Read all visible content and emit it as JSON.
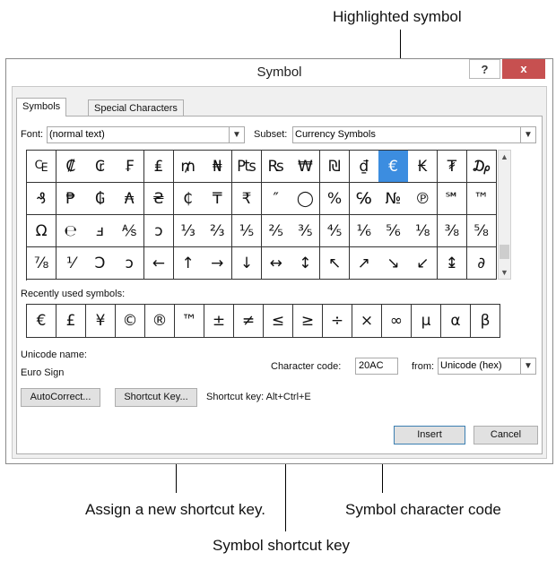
{
  "callouts": {
    "highlighted_symbol": "Highlighted symbol",
    "assign_shortcut": "Assign a new shortcut key.",
    "character_code": "Symbol character code",
    "shortcut_key": "Symbol shortcut key"
  },
  "dialog": {
    "title": "Symbol",
    "help_label": "?",
    "close_label": "x"
  },
  "tabs": [
    {
      "label": "Symbols"
    },
    {
      "label": "Special Characters"
    }
  ],
  "font": {
    "label": "Font:",
    "value": "(normal text)"
  },
  "subset": {
    "label": "Subset:",
    "value": "Currency Symbols"
  },
  "symbol_grid": [
    [
      "₠",
      "₡",
      "₢",
      "₣",
      "₤",
      "₥",
      "₦",
      "₧",
      "₨",
      "₩",
      "₪",
      "₫",
      "€",
      "₭",
      "₮",
      "₯"
    ],
    [
      "₰",
      "₱",
      "₲",
      "₳",
      "₴",
      "₵",
      "₸",
      "₹",
      "″",
      "◯",
      "%",
      "℅",
      "№",
      "℗",
      "℠",
      "™"
    ],
    [
      "Ω",
      "℮",
      "ⅎ",
      "⅍",
      "ↄ",
      "⅓",
      "⅔",
      "⅕",
      "⅖",
      "⅗",
      "⅘",
      "⅙",
      "⅚",
      "⅛",
      "⅜",
      "⅝"
    ],
    [
      "⅞",
      "⅟",
      "Ↄ",
      "ↄ",
      "←",
      "↑",
      "→",
      "↓",
      "↔",
      "↕",
      "↖",
      "↗",
      "↘",
      "↙",
      "↨",
      "∂"
    ]
  ],
  "selected_symbol": "€",
  "recent": {
    "label": "Recently used symbols:",
    "symbols": [
      "€",
      "£",
      "¥",
      "©",
      "®",
      "™",
      "±",
      "≠",
      "≤",
      "≥",
      "÷",
      "×",
      "∞",
      "µ",
      "α",
      "β"
    ]
  },
  "unicode": {
    "label": "Unicode name:",
    "value": "Euro Sign"
  },
  "char_code": {
    "label": "Character code:",
    "value": "20AC"
  },
  "from": {
    "label": "from:",
    "value": "Unicode (hex)"
  },
  "buttons": {
    "autocorrect": "AutoCorrect...",
    "shortcut_key": "Shortcut Key...",
    "insert": "Insert",
    "cancel": "Cancel"
  },
  "shortcut_text": "Shortcut key: Alt+Ctrl+E"
}
